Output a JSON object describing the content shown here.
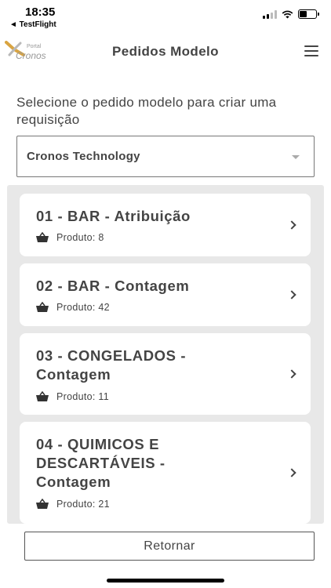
{
  "status_bar": {
    "time": "18:35",
    "back_label": "◄ TestFlight"
  },
  "header": {
    "logo_small": "Portal",
    "logo_big": "Cronos",
    "title": "Pedidos Modelo",
    "menu_icon": "hamburger-menu-icon"
  },
  "instruction": "Selecione o pedido modelo para criar uma requisição",
  "dropdown": {
    "selected": "Cronos Technology"
  },
  "orders": [
    {
      "title": "01 - BAR - Atribuição",
      "meta": "Produto: 8"
    },
    {
      "title": "02 - BAR - Contagem",
      "meta": "Produto: 42"
    },
    {
      "title": "03 - CONGELADOS - Contagem",
      "meta": "Produto: 11"
    },
    {
      "title": "04 - QUIMICOS E DESCARTÁVEIS - Contagem",
      "meta": "Produto: 21"
    }
  ],
  "footer": {
    "return_label": "Retornar"
  }
}
